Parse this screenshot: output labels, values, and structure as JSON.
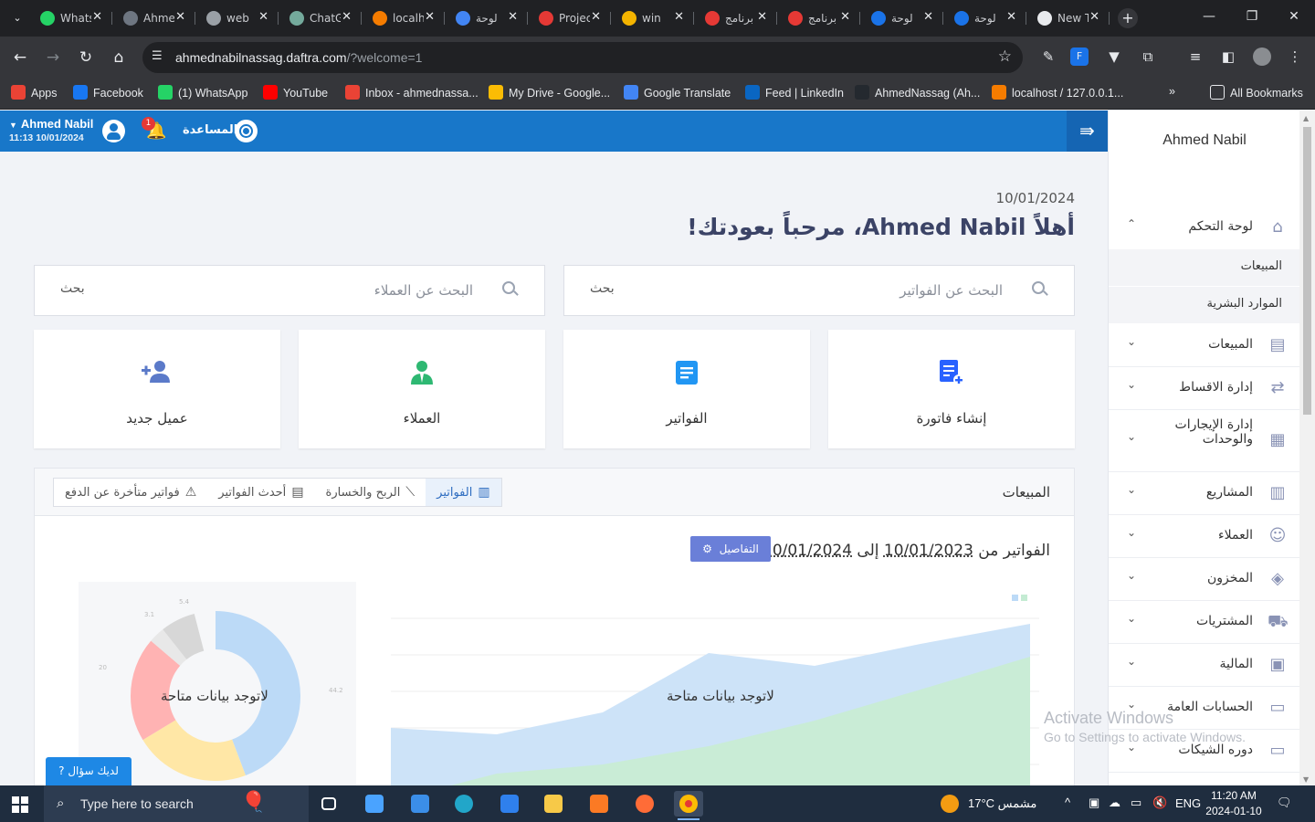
{
  "browser": {
    "tabs": [
      {
        "title": "WhatsApp",
        "color": "#25d366"
      },
      {
        "title": "Ahmed",
        "color": "#6e7681"
      },
      {
        "title": "web",
        "color": "#9aa0a6"
      },
      {
        "title": "ChatGPT",
        "color": "#74aa9c"
      },
      {
        "title": "localhost",
        "color": "#f57c00"
      },
      {
        "title": "لوحة",
        "color": "#4285f4"
      },
      {
        "title": "Project",
        "color": "#e53935"
      },
      {
        "title": "win",
        "color": "#f4b400"
      },
      {
        "title": "برنامج",
        "color": "#e53935"
      },
      {
        "title": "برنامج",
        "color": "#e53935"
      },
      {
        "title": "لوحة",
        "color": "#1a73e8"
      },
      {
        "title": "لوحة",
        "color": "#1a73e8"
      },
      {
        "title": "New Tab",
        "color": "#e8eaed"
      }
    ],
    "url_host": "ahmednabilnassag.daftra.com",
    "url_path": "/?welcome=1",
    "bookmarks": [
      {
        "label": "Apps",
        "color": "#ea4335"
      },
      {
        "label": "Facebook",
        "color": "#1877f2"
      },
      {
        "label": "(1) WhatsApp",
        "color": "#25d366"
      },
      {
        "label": "YouTube",
        "color": "#ff0000"
      },
      {
        "label": "Inbox - ahmednassa...",
        "color": "#ea4335"
      },
      {
        "label": "My Drive - Google...",
        "color": "#fbbc04"
      },
      {
        "label": "Google Translate",
        "color": "#4285f4"
      },
      {
        "label": "Feed | LinkedIn",
        "color": "#0a66c2"
      },
      {
        "label": "AhmedNassag (Ah...",
        "color": "#24292f"
      },
      {
        "label": "localhost / 127.0.0.1...",
        "color": "#f57c00"
      }
    ],
    "bookmarks_overflow": "»",
    "all_bookmarks": "All Bookmarks"
  },
  "topbar": {
    "user_name": "Ahmed Nabil",
    "user_time": "11:13 10/01/2024",
    "notification_count": "1",
    "help_label": "المساعدة",
    "accent": "#1877c9"
  },
  "main": {
    "date": "10/01/2024",
    "welcome": "أهلاً Ahmed Nabil، مرحباً بعودتك!",
    "search_invoices_placeholder": "البحث عن الفواتير",
    "search_clients_placeholder": "البحث عن العملاء",
    "search_button": "بحث",
    "cards": [
      {
        "label": "إنشاء فاتورة",
        "icon": "invoice-add-icon",
        "color": "#2962ff"
      },
      {
        "label": "الفواتير",
        "icon": "document-icon",
        "color": "#2196f3"
      },
      {
        "label": "العملاء",
        "icon": "client-icon",
        "color": "#2eb872"
      },
      {
        "label": "عميل جديد",
        "icon": "add-user-icon",
        "color": "#5b7ac9"
      }
    ],
    "sales_title": "المبيعات",
    "sales_tabs": [
      {
        "label": "الفواتير",
        "icon": "bar-chart-icon"
      },
      {
        "label": "الربح والخسارة",
        "icon": "line-chart-icon"
      },
      {
        "label": "أحدث الفواتير",
        "icon": "file-icon"
      },
      {
        "label": "فواتير متأخرة عن الدفع",
        "icon": "warning-icon"
      }
    ],
    "range_prefix": "الفواتير من",
    "range_from": "10/01/2023",
    "range_mid": "إلى",
    "range_to": "10/01/2024",
    "details_button": "التفاصيل",
    "no_data": "لاتوجد بيانات متاحة",
    "pie_labels": [
      "3.1",
      "5.4",
      "20",
      "44.2"
    ],
    "chat_button": "لديك سؤال"
  },
  "sidebar": {
    "user_name": "Ahmed Nabil",
    "items": [
      {
        "label": "لوحة التحكم",
        "icon": "home-icon",
        "chevron": "⌃"
      },
      {
        "label": "المبيعات",
        "icon": "sales-icon",
        "chevron": "⌄"
      },
      {
        "label": "إدارة الاقساط",
        "icon": "installments-icon",
        "chevron": "⌄"
      },
      {
        "label": "إدارة الإيجارات والوحدات",
        "icon": "rental-icon",
        "chevron": "⌄"
      },
      {
        "label": "المشاريع",
        "icon": "projects-icon",
        "chevron": "⌄"
      },
      {
        "label": "العملاء",
        "icon": "clients-icon",
        "chevron": "⌄"
      },
      {
        "label": "المخزون",
        "icon": "inventory-icon",
        "chevron": "⌄"
      },
      {
        "label": "المشتريات",
        "icon": "truck-icon",
        "chevron": "⌄"
      },
      {
        "label": "المالية",
        "icon": "finance-icon",
        "chevron": "⌄"
      },
      {
        "label": "الحسابات العامة",
        "icon": "accounts-icon",
        "chevron": "⌄"
      },
      {
        "label": "دوره الشيكات",
        "icon": "cheques-icon",
        "chevron": "⌄"
      }
    ],
    "sub_items": [
      "المبيعات",
      "الموارد البشرية"
    ]
  },
  "watermark": {
    "line1": "Activate Windows",
    "line2": "Go to Settings to activate Windows."
  },
  "taskbar": {
    "search_placeholder": "Type here to search",
    "weather": "17°C  مشمس",
    "lang": "ENG",
    "time": "11:20 AM",
    "date": "2024-01-10"
  }
}
